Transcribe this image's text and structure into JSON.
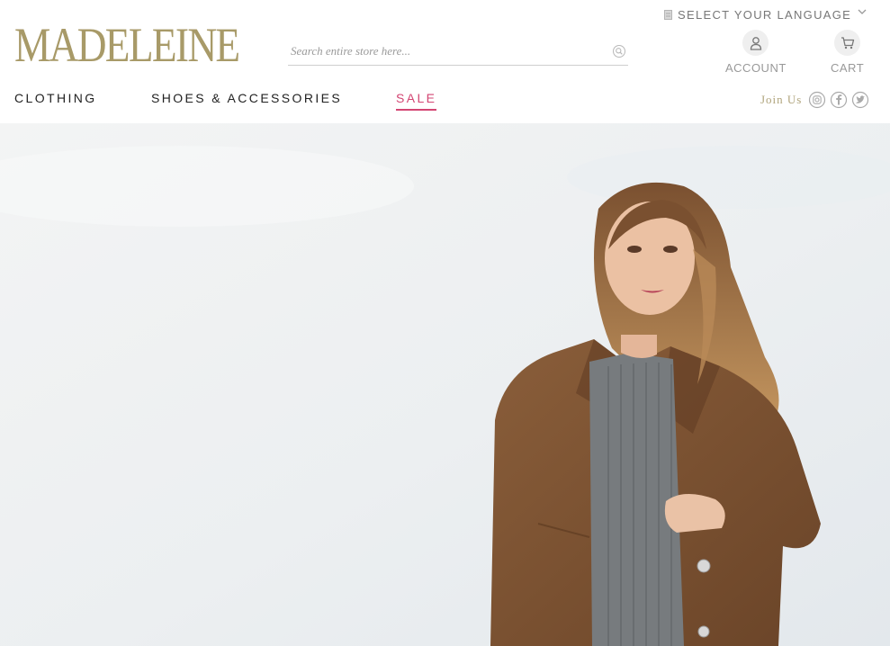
{
  "brand": {
    "logo_text": "MADELEINE",
    "logo_color": "#a89a68"
  },
  "search": {
    "placeholder": "Search entire store here..."
  },
  "language": {
    "label": "SELECT YOUR LANGUAGE"
  },
  "header_actions": {
    "account_label": "ACCOUNT",
    "cart_label": "CART"
  },
  "nav": {
    "items": [
      {
        "label": "CLOTHING"
      },
      {
        "label": "SHOES & ACCESSORIES"
      },
      {
        "label": "SALE",
        "color": "#d34673"
      }
    ]
  },
  "social": {
    "join_label": "Join Us",
    "icons": [
      "instagram-icon",
      "facebook-icon",
      "twitter-icon"
    ]
  },
  "hero": {
    "background": "#eef0f2",
    "coat_color": "#7a5232",
    "sweater_color": "#777b7e",
    "hair_color": "#a2703e"
  }
}
